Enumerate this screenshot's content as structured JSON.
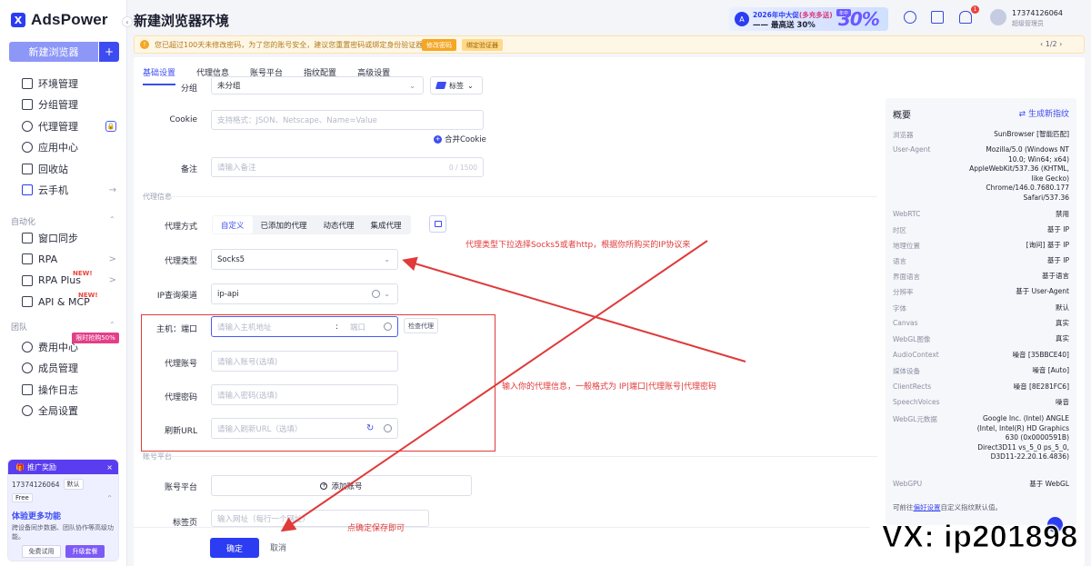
{
  "app": {
    "logo_mark": "X",
    "name": "AdsPower",
    "page_title": "新建浏览器环境"
  },
  "sidebar": {
    "new_env_label": "新建浏览器",
    "new_env_add": "+",
    "items": [
      {
        "label": "环境管理"
      },
      {
        "label": "分组管理"
      },
      {
        "label": "代理管理"
      },
      {
        "label": "应用中心"
      },
      {
        "label": "回收站"
      },
      {
        "label": "云手机",
        "right": "→"
      }
    ],
    "section_automation": "自动化",
    "automation_items": [
      {
        "label": "窗口同步"
      },
      {
        "label": "RPA",
        "right": ">"
      },
      {
        "label": "RPA Plus",
        "badge": "NEW!",
        "right": ">"
      },
      {
        "label": "API & MCP",
        "badge": "NEW!"
      }
    ],
    "section_team": "团队",
    "discount_tag": "限时抢购50%",
    "team_items": [
      {
        "label": "费用中心"
      },
      {
        "label": "成员管理"
      },
      {
        "label": "操作日志"
      },
      {
        "label": "全局设置"
      }
    ],
    "promo": {
      "head": "推广奖励",
      "close": "×",
      "phone": "17374126064",
      "tag": "默认",
      "free": "Free",
      "title": "体验更多功能",
      "desc": "跨设备同步数据、团队协作等高级功能。",
      "btn_trial": "免费试用",
      "btn_upgrade": "升级套餐"
    }
  },
  "topbar": {
    "ad_line1": "2026年中大促",
    "ad_line1_tag": "(多充多送)",
    "ad_line2": "—— 最高送 30%",
    "ad_big": "30%",
    "ad_badge": "年中",
    "phone": "17374126064",
    "role": "超级管理员",
    "bell_count": "1"
  },
  "notice": {
    "text": "您已超过100天未修改密码，为了您的账号安全，建议您重置密码或绑定身份验证器！",
    "btn_change": "修改密码",
    "btn_bind": "绑定验证器",
    "page": "1/2"
  },
  "tabs": [
    "基础设置",
    "代理信息",
    "账号平台",
    "指纹配置",
    "高级设置"
  ],
  "form": {
    "group_label": "分组",
    "group_value": "未分组",
    "tag_value": "标签",
    "cookie_label": "Cookie",
    "cookie_placeholder": "支持格式：JSON、Netscape、Name=Value",
    "merge_cookie": "合并Cookie",
    "note_label": "备注",
    "note_placeholder": "请输入备注",
    "note_counter": "0 / 1500",
    "proxy_section": "代理信息",
    "proxy_mode_label": "代理方式",
    "proxy_modes": [
      "自定义",
      "已添加的代理",
      "动态代理",
      "集成代理"
    ],
    "proxy_type_label": "代理类型",
    "proxy_type_value": "Socks5",
    "ip_channel_label": "IP查询渠道",
    "ip_channel_value": "ip-api",
    "host_label": "主机：端口",
    "host_placeholder": "请输入主机地址",
    "port_sep": ":",
    "port_placeholder": "端口",
    "check_proxy": "检查代理",
    "account_label": "代理账号",
    "account_placeholder": "请输入账号(选填)",
    "password_label": "代理密码",
    "password_placeholder": "请输入密码(选填)",
    "refresh_label": "刷新URL",
    "refresh_placeholder": "请输入刷新URL（选填）",
    "platform_section": "账号平台",
    "platform_label": "账号平台",
    "add_account": "添加账号",
    "tabs_label": "标签页",
    "tabs_placeholder": "输入网址（每行一个网址）"
  },
  "footer": {
    "ok": "确定",
    "cancel": "取消"
  },
  "overview": {
    "title": "概要",
    "generate": "生成新指纹",
    "rows": [
      {
        "k": "浏览器",
        "v": "SunBrowser [智能匹配]"
      },
      {
        "k": "User-Agent",
        "v": "Mozilla/5.0 (Windows NT 10.0; Win64; x64) AppleWebKit/537.36 (KHTML, like Gecko) Chrome/146.0.7680.177 Safari/537.36"
      },
      {
        "k": "WebRTC",
        "v": "禁用"
      },
      {
        "k": "时区",
        "v": "基于 IP"
      },
      {
        "k": "地理位置",
        "v": "[询问] 基于 IP"
      },
      {
        "k": "语言",
        "v": "基于 IP"
      },
      {
        "k": "界面语言",
        "v": "基于语言"
      },
      {
        "k": "分辨率",
        "v": "基于 User-Agent"
      },
      {
        "k": "字体",
        "v": "默认"
      },
      {
        "k": "Canvas",
        "v": "真实"
      },
      {
        "k": "WebGL图像",
        "v": "真实"
      },
      {
        "k": "AudioContext",
        "v": "噪音 [35BBCE40]"
      },
      {
        "k": "媒体设备",
        "v": "噪音 [Auto]"
      },
      {
        "k": "ClientRects",
        "v": "噪音 [8E281FC6]"
      },
      {
        "k": "SpeechVoices",
        "v": "噪音"
      },
      {
        "k": "WebGL元数据",
        "v": "Google Inc. (Intel) ANGLE (Intel, Intel(R) HD Graphics 630 (0x0000591B) Direct3D11 vs_5_0 ps_5_0, D3D11-22.20.16.4836)"
      },
      {
        "k": "WebGPU",
        "v": "基于 WebGL"
      }
    ],
    "foot_prefix": "可前往",
    "foot_link": "偏好设置",
    "foot_suffix": "自定义指纹默认值。"
  },
  "annotations": {
    "a1": "代理类型下拉选择Socks5或者http，根据你所购买的IP协议来",
    "a2": "输入你的代理信息，一般格式为 IP|端口|代理账号|代理密码",
    "a3": "点确定保存即可",
    "accent": "#e03a3a"
  },
  "watermark": "VX: ip201898"
}
